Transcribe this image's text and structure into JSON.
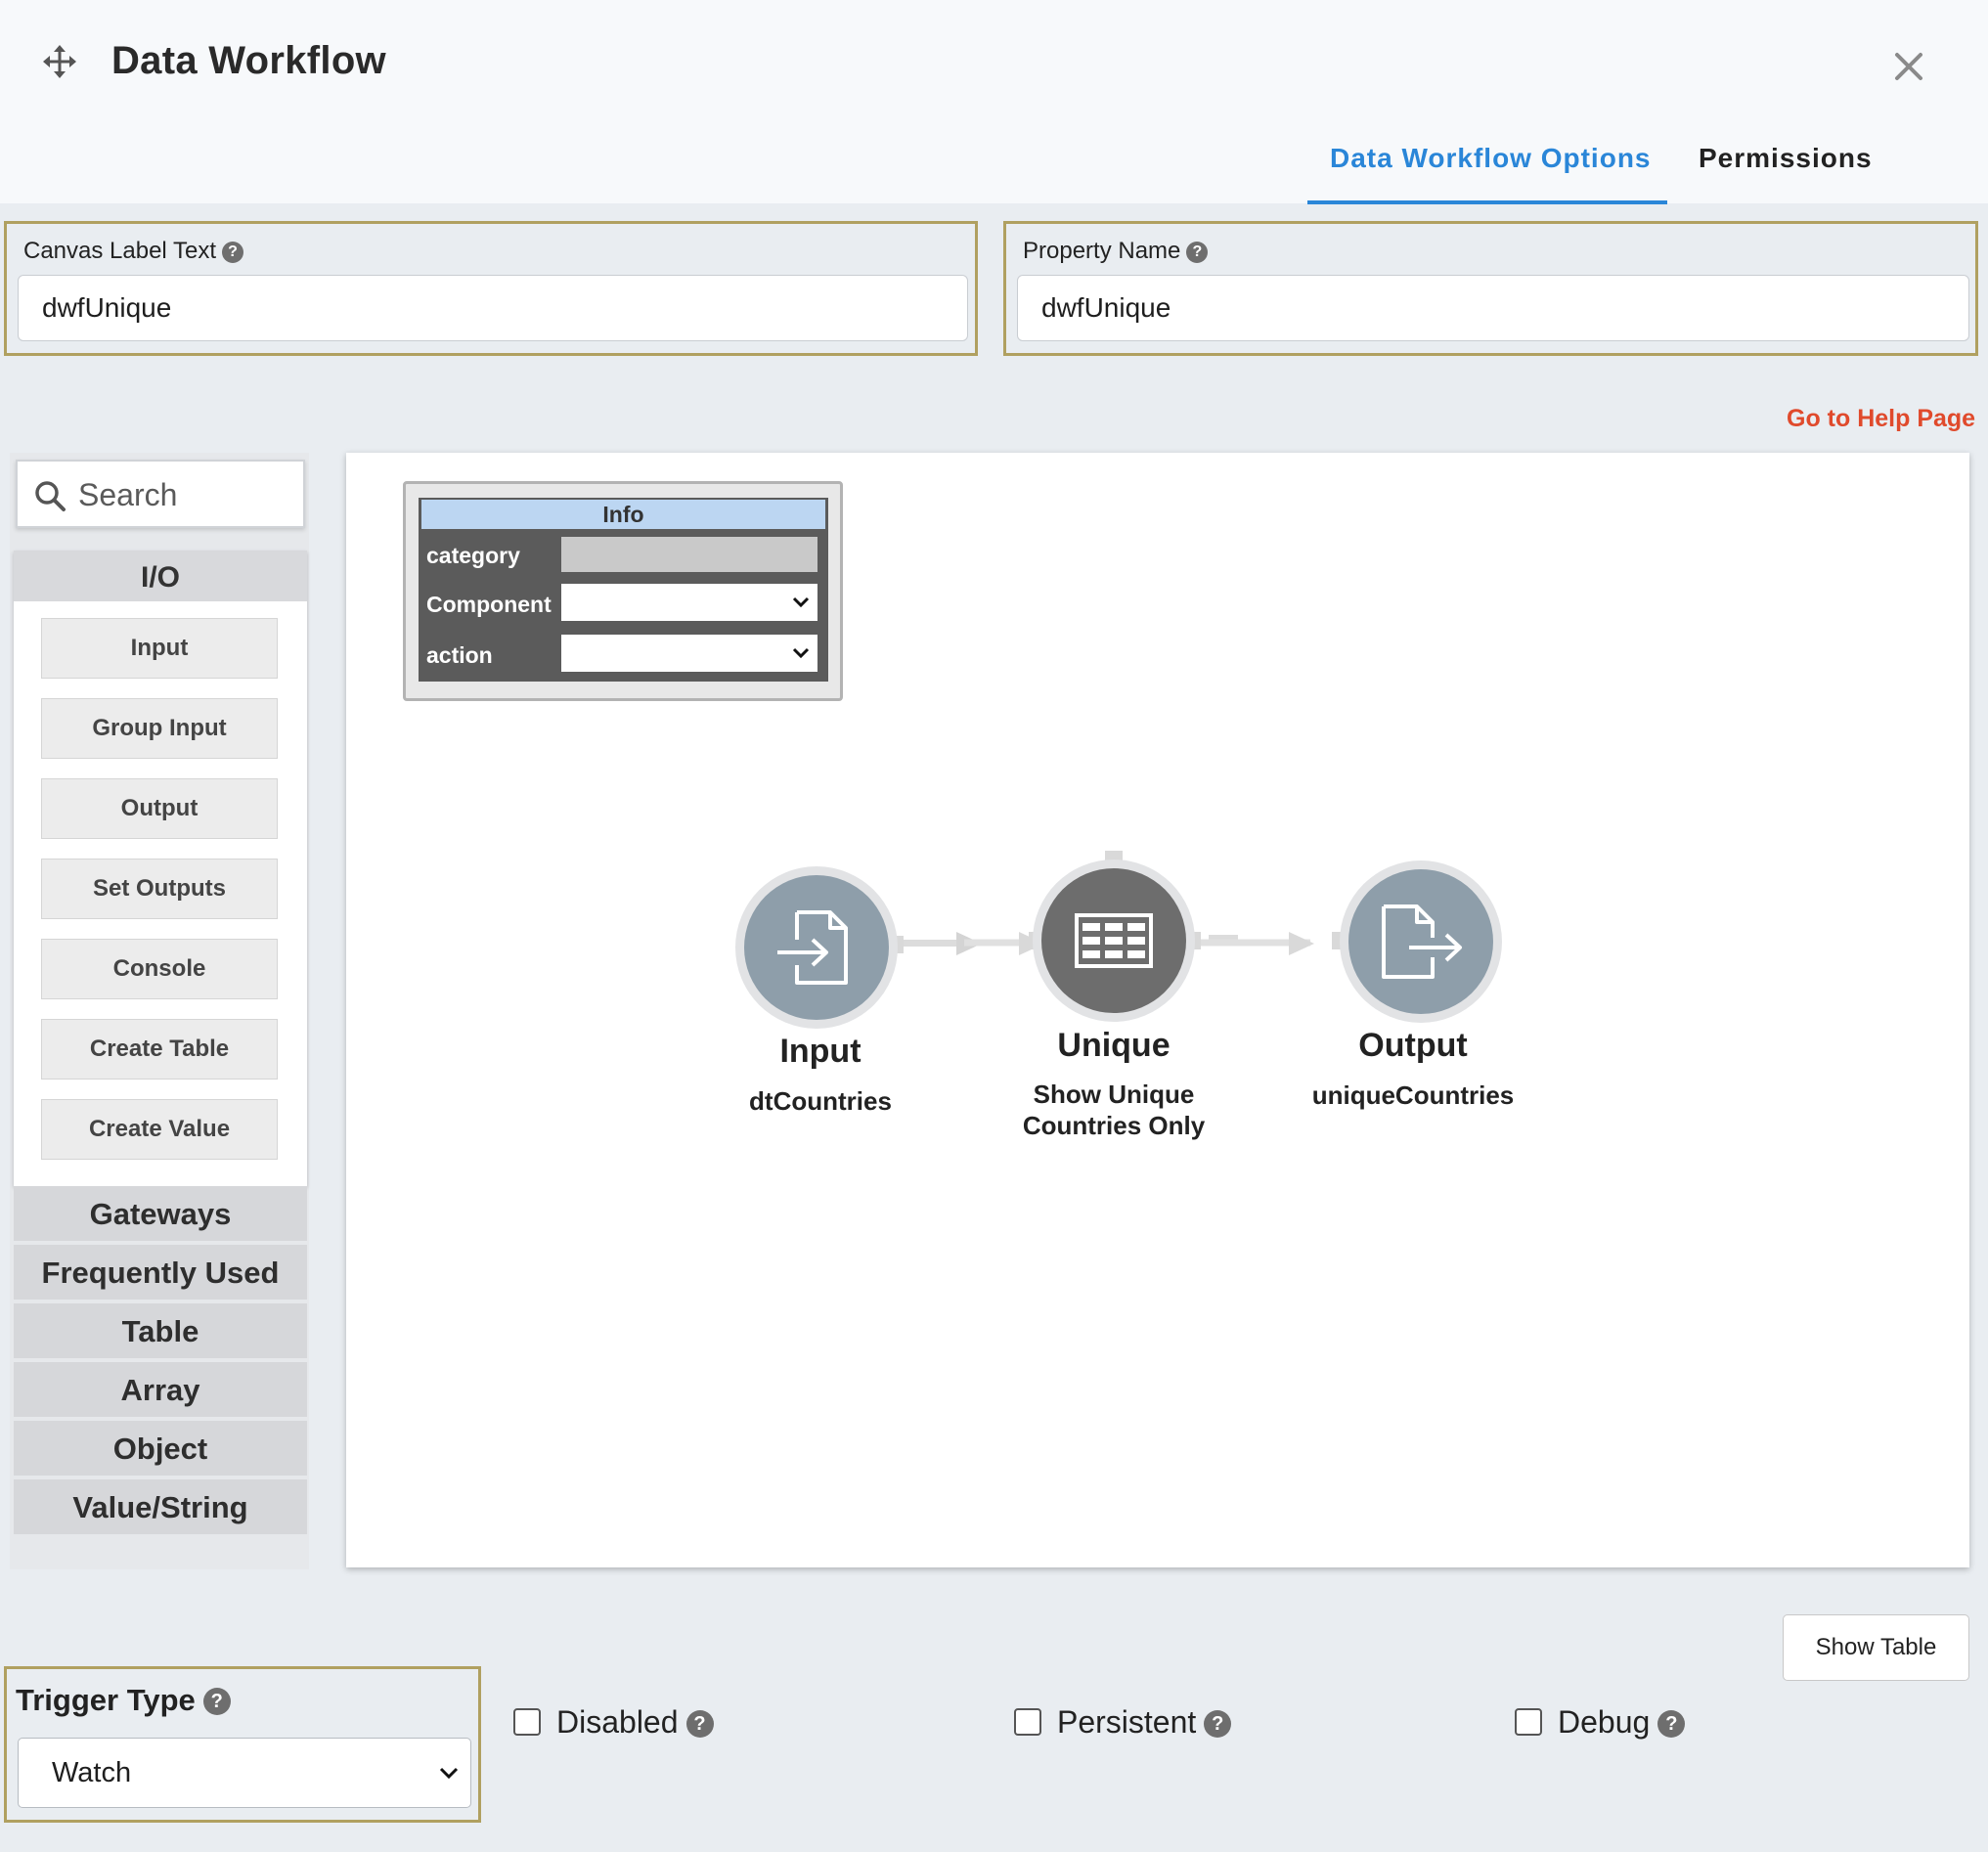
{
  "dialog": {
    "title": "Data Workflow",
    "tabs": [
      {
        "label": "Data Workflow Options",
        "active": true
      },
      {
        "label": "Permissions",
        "active": false
      }
    ]
  },
  "fields": {
    "canvas_label": {
      "label": "Canvas Label Text",
      "value": "dwfUnique"
    },
    "property_name": {
      "label": "Property Name",
      "value": "dwfUnique"
    }
  },
  "help_link": "Go to Help Page",
  "palette": {
    "search_placeholder": "Search",
    "io_header": "I/O",
    "io_items": [
      "Input",
      "Group Input",
      "Output",
      "Set Outputs",
      "Console",
      "Create Table",
      "Create Value"
    ],
    "categories": [
      "Gateways",
      "Frequently Used",
      "Table",
      "Array",
      "Object",
      "Value/String"
    ]
  },
  "info_box": {
    "title": "Info",
    "rows": [
      "category",
      "Component",
      "action"
    ]
  },
  "nodes": [
    {
      "title": "Input",
      "subtitle": "dtCountries",
      "icon": "file-import-icon"
    },
    {
      "title": "Unique",
      "subtitle_lines": [
        "Show Unique",
        "Countries Only"
      ],
      "icon": "table-grid-icon"
    },
    {
      "title": "Output",
      "subtitle": "uniqueCountries",
      "icon": "file-export-icon"
    }
  ],
  "show_table_label": "Show Table",
  "trigger": {
    "label": "Trigger Type",
    "value": "Watch"
  },
  "checkboxes": [
    {
      "label": "Disabled",
      "checked": false
    },
    {
      "label": "Persistent",
      "checked": false
    },
    {
      "label": "Debug",
      "checked": false
    }
  ],
  "colors": {
    "accent": "#2a86d8",
    "help_link": "#e04a2c",
    "highlight_border": "#b0a060",
    "node_gray_blue": "#8e9eaa",
    "node_dark": "#6d6d6d"
  }
}
